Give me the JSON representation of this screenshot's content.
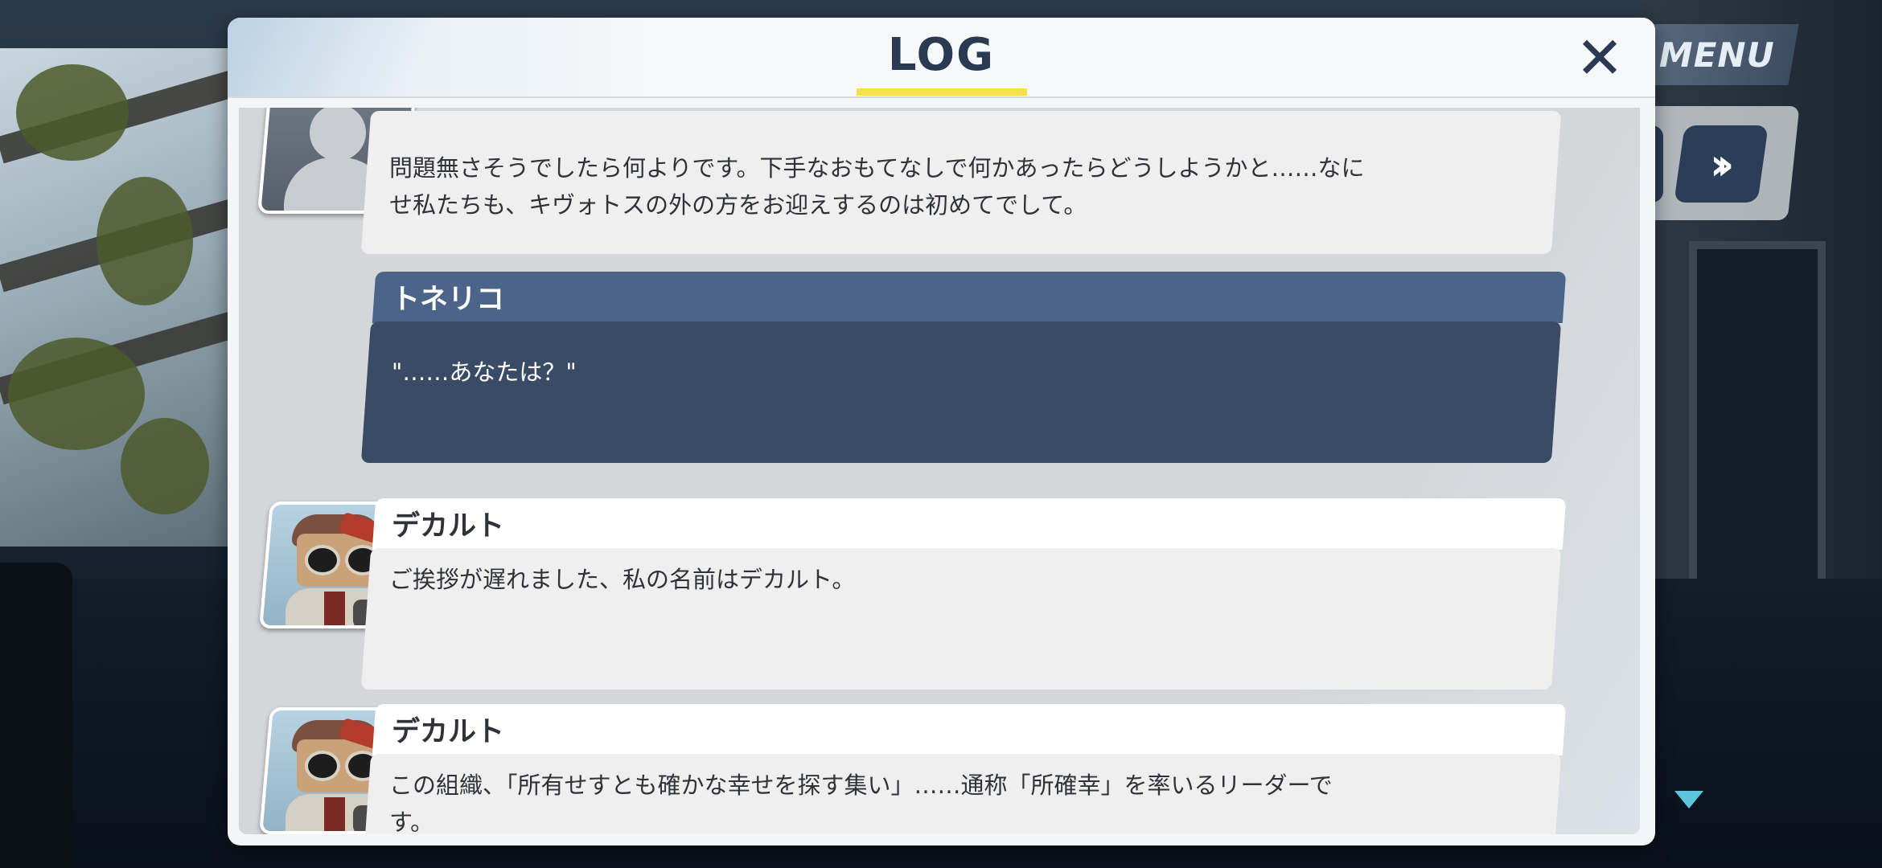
{
  "hud": {
    "menu_label": "MENU",
    "fast_forward_icon": "double-chevron-right-icon"
  },
  "log": {
    "title": "LOG",
    "close_icon": "✕",
    "entries": [
      {
        "speaker": "",
        "avatar": "placeholder-silhouette",
        "text_lines": [
          "問題無さそうでしたら何よりです。下手なおもてなしで何かあったらどうしようかと……なに",
          "せ私たちも、キヴォトスの外の方をお迎えするのは初めてでして。"
        ]
      },
      {
        "speaker": "トネリコ",
        "avatar": "none",
        "text_lines": [
          "\"……あなたは？\""
        ]
      },
      {
        "speaker": "デカルト",
        "avatar": "descartes",
        "text_lines": [
          "ご挨拶が遅れました、私の名前はデカルト。"
        ]
      },
      {
        "speaker": "デカルト",
        "avatar": "descartes",
        "text_lines": [
          "この組織、「所有せすとも確かな幸せを探す集い」……通称「所確幸」を率いるリーダーで",
          "す。"
        ]
      }
    ]
  },
  "colors": {
    "accent_yellow": "#f5e04a",
    "player_name_bar": "#4b6487",
    "player_bubble": "#3a4b66",
    "title_text": "#2a3a52",
    "scroll_indicator": "#5ec6dc"
  }
}
